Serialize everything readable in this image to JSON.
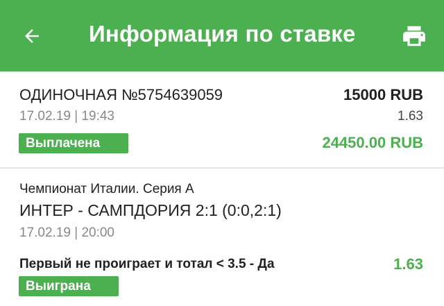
{
  "header": {
    "title": "Информация по ставке",
    "back_icon": "arrow-left-icon",
    "print_icon": "printer-icon",
    "background_color": "#4caf50"
  },
  "bet": {
    "type_number": "ОДИНОЧНАЯ №5754639059",
    "stake": "15000 RUB",
    "date": "17.02.19 | 19:43",
    "odds": "1.63",
    "status": "Выплачена",
    "payout": "24450.00 RUB"
  },
  "event": {
    "tournament": "Чемпионат Италии. Серия А",
    "match": "ИНТЕР - САМПДОРИЯ 2:1 (0:0,2:1)",
    "date": "17.02.19 | 20:00",
    "selection": "Первый не проиграет и тотал < 3.5 - Да",
    "odds": "1.63",
    "status": "Выиграна"
  },
  "colors": {
    "accent_green": "#4caf50",
    "text_dark": "#212121",
    "text_muted": "#888888"
  }
}
